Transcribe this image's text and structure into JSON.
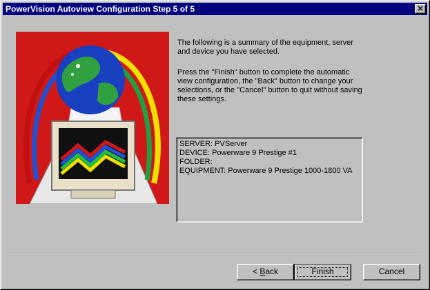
{
  "window": {
    "title": "PowerVision Autoview Configuration Step 5 of 5",
    "close_glyph": "×"
  },
  "intro": {
    "paragraph1": "The following is a summary of the equipment, server and device you have selected.",
    "paragraph2": "Press the \"Finish\" button to complete the automatic view configuration,  the \"Back\" button to change your selections, or the \"Cancel\" button to quit without saving these settings."
  },
  "summary": {
    "lines": [
      "SERVER: PVServer",
      "DEVICE: Powerware 9 Prestige #1",
      "FOLDER:",
      "EQUIPMENT: Powerware 9 Prestige 1000-1800 VA"
    ]
  },
  "buttons": {
    "back_prefix": "< ",
    "back_mnemonic": "B",
    "back_rest": "ack",
    "finish": "Finish",
    "cancel": "Cancel"
  },
  "illustration": {
    "icon": "globe-monitor-icon",
    "colors": {
      "background": "#d01818",
      "globe_ocean": "#1840c0",
      "globe_land": "#30a040",
      "monitor": "#e8e0c8",
      "screen": "#101010",
      "pedestal": "#e8e8e8"
    }
  }
}
